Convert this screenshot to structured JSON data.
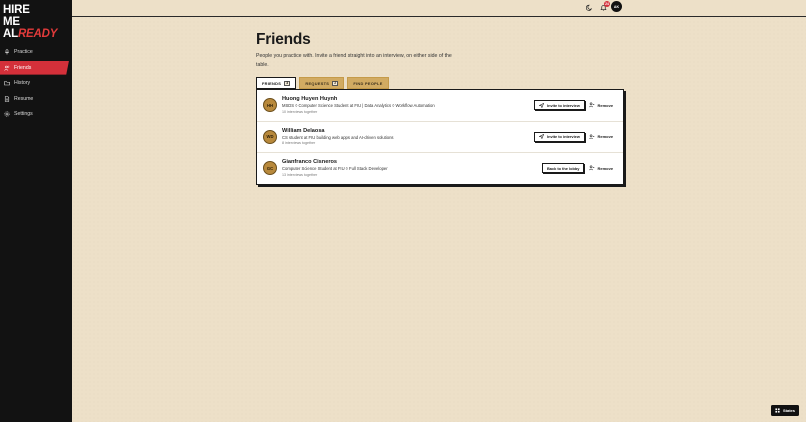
{
  "logo": {
    "line1": "HIRE",
    "line2": "ME",
    "line3_plain": "AL",
    "line3_accent": "READY"
  },
  "sidebar": {
    "items": [
      {
        "label": "Practice",
        "icon": "mic-icon",
        "active": false
      },
      {
        "label": "Friends",
        "icon": "users-icon",
        "active": true
      },
      {
        "label": "History",
        "icon": "folder-icon",
        "active": false
      },
      {
        "label": "Resume",
        "icon": "document-icon",
        "active": false
      },
      {
        "label": "Settings",
        "icon": "gear-icon",
        "active": false
      }
    ]
  },
  "topbar": {
    "notification_count": "24",
    "avatar_initials": "AK"
  },
  "page": {
    "title": "Friends",
    "subtitle": "People you practice with. Invite a friend straight into an interview, on either side of the table."
  },
  "tabs": [
    {
      "label": "FRIENDS",
      "count": "3",
      "active": true
    },
    {
      "label": "REQUESTS",
      "count": "2",
      "active": false
    },
    {
      "label": "FIND PEOPLE",
      "count": "",
      "active": false
    }
  ],
  "friends": [
    {
      "initials": "HH",
      "name": "Huong Huyen Huynh",
      "desc": "MSDS ◊ Computer Science Student at FIU | Data Analytics ◊ Workflow Automation",
      "meta": "10 interviews together",
      "action": "Invite to interview",
      "remove": "Remove"
    },
    {
      "initials": "WD",
      "name": "William Delaosa",
      "desc": "CS student at FIU building web apps and AI-driven solutions",
      "meta": "8 interviews together",
      "action": "Invite to interview",
      "remove": "Remove"
    },
    {
      "initials": "GC",
      "name": "Gianfranco Cisneros",
      "desc": "Computer Science Student at FIU ◊ Full Stack Developer",
      "meta": "13 interviews together",
      "action": "Back to the lobby",
      "remove": "Remove"
    }
  ],
  "states_button": "States",
  "colors": {
    "accent": "#d4303a",
    "tab_gold": "#d2ab62",
    "background": "#ede0c8",
    "sidebar": "#121212"
  }
}
